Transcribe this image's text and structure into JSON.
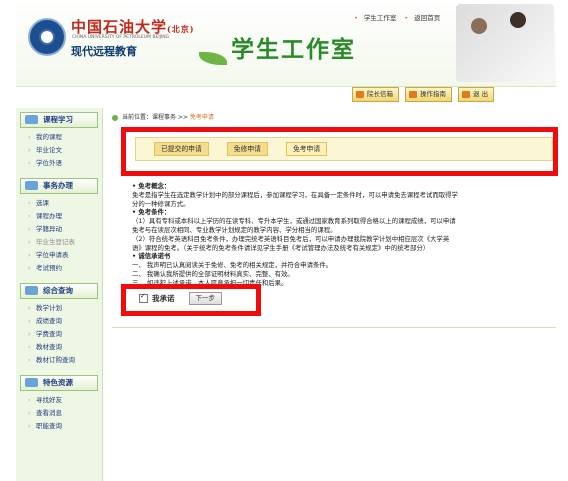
{
  "header": {
    "university_cn": "中国石油大学",
    "university_suffix": "(北京)",
    "university_en": "CHINA UNIVERSITY OF PETROLEUM BEIJING",
    "school": "现代远程教育",
    "title": "学生工作室",
    "top_links": [
      "学生工作室",
      "返回首页"
    ],
    "nav_buttons": [
      "院长信箱",
      "操作指南",
      "退 出"
    ]
  },
  "sidebar": {
    "sections": [
      {
        "title": "课程学习",
        "items": [
          "我的课程",
          "毕业论文",
          "学位外语"
        ]
      },
      {
        "title": "事务办理",
        "items": [
          "选课",
          "课程办理",
          "学籍异动",
          "毕业生登记表",
          "学位申请表",
          "考试预约"
        ]
      },
      {
        "title": "综合查询",
        "items": [
          "教学计划",
          "成绩查询",
          "学费查询",
          "教材查询",
          "教材订购查询"
        ]
      },
      {
        "title": "特色资源",
        "items": [
          "寻找好友",
          "查看消息",
          "职能查询"
        ]
      }
    ]
  },
  "breadcrumb": {
    "prefix": "当前位置：课程事务 >> ",
    "current": "免考申请"
  },
  "tabs": [
    "已提交的申请",
    "免修申请",
    "免考申请"
  ],
  "content": {
    "lines": [
      "• 免考概念：",
      "免考是指学生在选定教学计划中的部分课程后，参加课程学习，在具备一定条件时，可以申请免去课程考试而取得学",
      "分的一种修课方式。",
      "• 免考条件：",
      "（1）具有专科或本科以上学历的在读专科、专升本学生，或通过国家教育系列取得合格以上的课程成绩，可以申请",
      "免考与在读层次相同、专业教学计划规定的教学内容、学分相当的课程。",
      "（2）符合统考英语科目免考条件，办理完统考英语科目免考后，可以申请办理我院教学计划中相应层次《大学英",
      "语》课程的免考。（关于统考的免考条件请详见学生手册《考试管理办法及统考有关规定》中的统考部分）",
      "• 诚信承诺书",
      "一、 我声明已认真阅读关于免修、免考的相关规定，并符合申请条件。",
      "二、 我确认我所提供的全部证明材料真实、完整、有效。",
      "三、 如违犯上述承诺，本人愿意承担一切责任和后果。"
    ],
    "agree_label": "我承诺",
    "next_button": "下一步"
  },
  "colors": {
    "accent": "#f00c0c",
    "title_green": "#2a8a2a",
    "nav_blue": "#1f3f7f"
  }
}
